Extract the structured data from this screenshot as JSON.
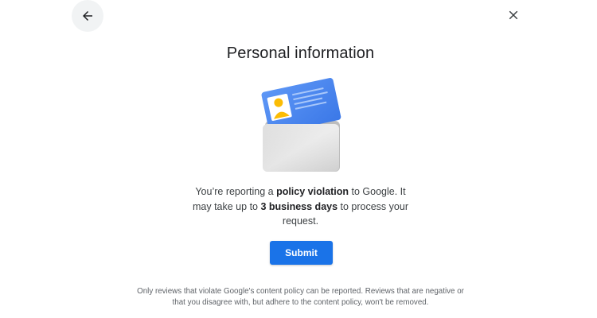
{
  "header": {
    "back_icon": "arrow-back-icon",
    "close_icon": "close-icon"
  },
  "title": "Personal information",
  "illustration": {
    "icon": "id-card-in-wallet-illustration",
    "card_color": "#4285f4",
    "avatar_color": "#fbbc04",
    "wallet_color": "#d7d7d7"
  },
  "message": {
    "part1": "You’re reporting a ",
    "bold1": "policy violation",
    "part2": " to Google. It may take up to ",
    "bold2": "3 business days",
    "part3": " to process your request."
  },
  "submit": {
    "label": "Submit",
    "color": "#1a73e8"
  },
  "footnote": "Only reviews that violate Google's content policy can be reported. Reviews that are negative or that you disagree with, but adhere to the content policy, won't be removed."
}
